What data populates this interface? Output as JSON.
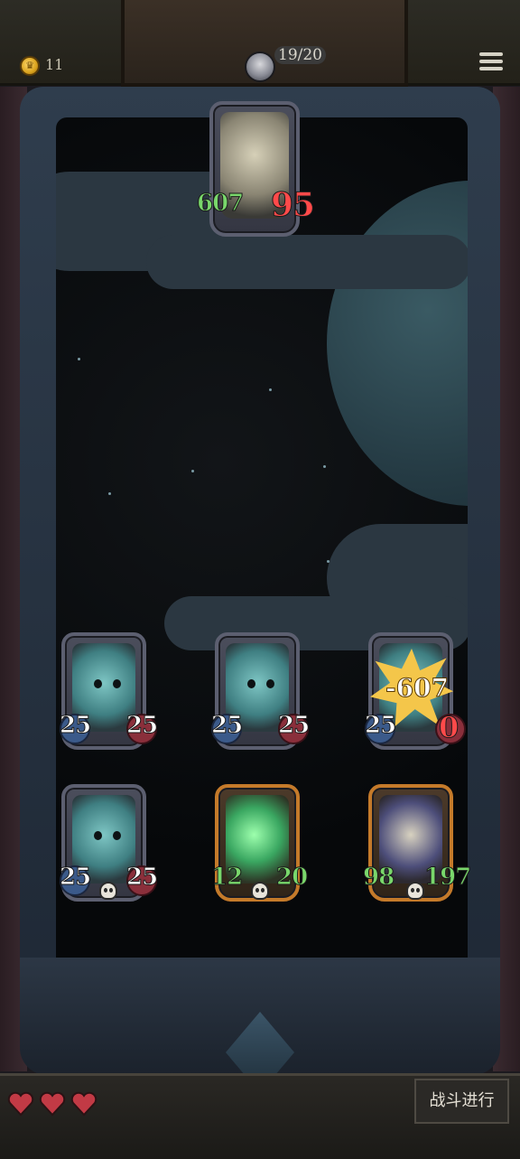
{
  "header": {
    "coins": "11",
    "moves": "19/20"
  },
  "boss": {
    "name": "hero-card",
    "hp": "607",
    "attack": "95"
  },
  "enemies": [
    {
      "type": "ghoul",
      "hp": "25",
      "attack": "25"
    },
    {
      "type": "ghoul",
      "hp": "25",
      "attack": "25"
    },
    {
      "type": "ghoul",
      "hp": "25",
      "attack": "0",
      "damage": "-607"
    },
    {
      "type": "ghoul",
      "hp": "25",
      "attack": "25",
      "deathrattle": true
    },
    {
      "type": "green-spirit",
      "hp": "12",
      "attack": "20",
      "deathrattle": true
    },
    {
      "type": "pirate-captain",
      "hp": "98",
      "attack": "197",
      "deathrattle": true
    }
  ],
  "footer": {
    "lives": 3,
    "battle_button_label": "战斗进行"
  },
  "colors": {
    "accent_gold": "#c47a2a",
    "damage_star": "#f4c64a",
    "hp_green": "#79d76b",
    "attack_red": "#ff4a4a"
  }
}
